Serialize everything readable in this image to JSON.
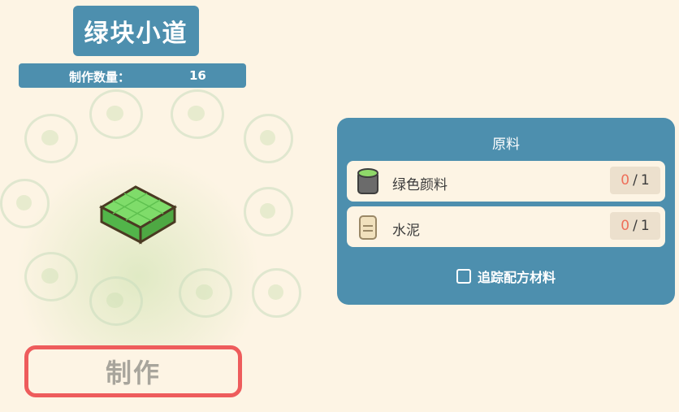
{
  "item": {
    "title": "绿块小道",
    "quantity_label": "制作数量：",
    "quantity_value": "16",
    "icon": "green-block-path-icon"
  },
  "craft_button": {
    "label": "制作"
  },
  "materials": {
    "title": "原料",
    "items": [
      {
        "name": "绿色颜料",
        "have": "0",
        "need": "1",
        "icon": "green-paint-bucket-icon"
      },
      {
        "name": "水泥",
        "have": "0",
        "need": "1",
        "icon": "cement-bag-icon"
      }
    ],
    "track_label": "追踪配方材料",
    "track_checked": false
  },
  "colors": {
    "accent": "#4d8fae",
    "background": "#fdf4e4",
    "button_border": "#ee5c5c",
    "count_have": "#ee6f5a"
  }
}
